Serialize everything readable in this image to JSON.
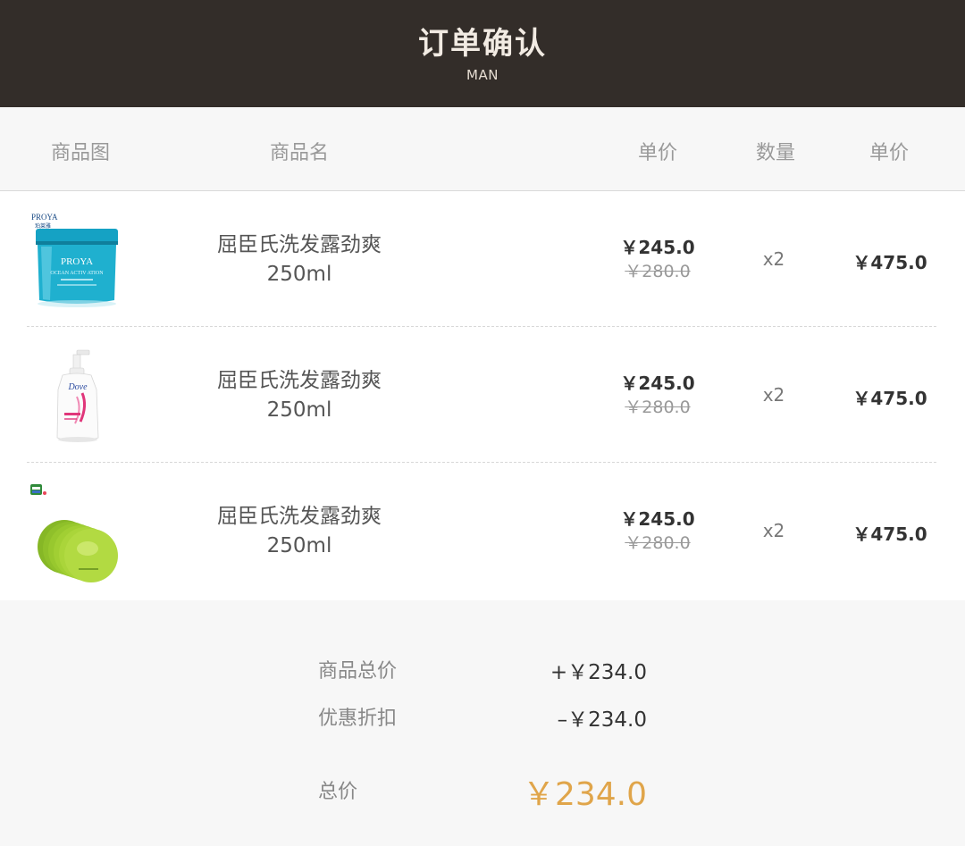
{
  "header": {
    "title": "订单确认",
    "subtitle": "MAN"
  },
  "columns": {
    "image": "商品图",
    "name": "商品名",
    "unit_price": "单价",
    "quantity": "数量",
    "subtotal": "单价"
  },
  "items": [
    {
      "name_line1": "屈臣氏洗发露劲爽",
      "name_line2": "250ml",
      "price": "￥245.0",
      "original_price": "￥280.0",
      "quantity": "x2",
      "subtotal": "￥475.0",
      "brand": "PROYA",
      "brand_cn": "珀莱雅",
      "product_text": "OCEAN ACTIV ATION"
    },
    {
      "name_line1": "屈臣氏洗发露劲爽",
      "name_line2": "250ml",
      "price": "￥245.0",
      "original_price": "￥280.0",
      "quantity": "x2",
      "subtotal": "￥475.0",
      "brand": "Dove"
    },
    {
      "name_line1": "屈臣氏洗发露劲爽",
      "name_line2": "250ml",
      "price": "￥245.0",
      "original_price": "￥280.0",
      "quantity": "x2",
      "subtotal": "￥475.0"
    }
  ],
  "summary": {
    "goods_total_label": "商品总价",
    "goods_total_value": "+￥234.0",
    "discount_label": "优惠折扣",
    "discount_value": "–￥234.0",
    "total_label": "总价",
    "total_value": "￥234.0"
  },
  "colors": {
    "header_bg": "#332d29",
    "accent": "#e0a54a",
    "jar": "#1aa3c6",
    "dove_pink": "#e0367a",
    "mask_green": "#9ccb2b"
  }
}
